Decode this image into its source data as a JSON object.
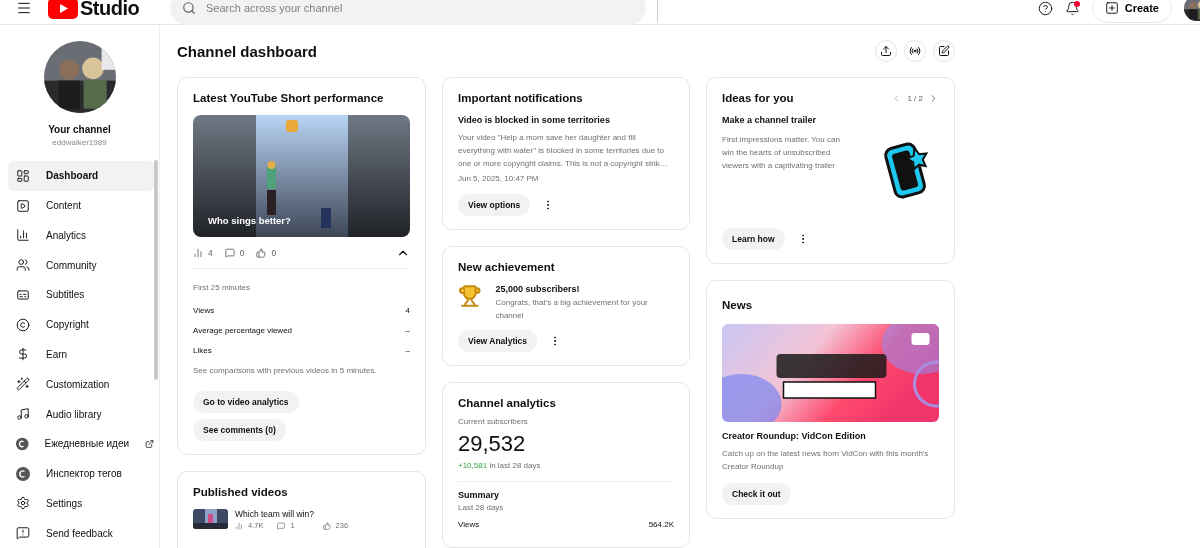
{
  "header": {
    "logo": "Studio",
    "search_placeholder": "Search across your channel",
    "create_label": "Create",
    "notifications_unread": true
  },
  "sidebar": {
    "channel_name": "Your channel",
    "channel_handle": "eddwalker1989",
    "items": [
      {
        "label": "Dashboard",
        "selected": true,
        "external": false
      },
      {
        "label": "Content",
        "selected": false,
        "external": false
      },
      {
        "label": "Analytics",
        "selected": false,
        "external": false
      },
      {
        "label": "Community",
        "selected": false,
        "external": false
      },
      {
        "label": "Subtitles",
        "selected": false,
        "external": false
      },
      {
        "label": "Copyright",
        "selected": false,
        "external": false
      },
      {
        "label": "Earn",
        "selected": false,
        "external": false
      },
      {
        "label": "Customization",
        "selected": false,
        "external": false
      },
      {
        "label": "Audio library",
        "selected": false,
        "external": false
      },
      {
        "label": "Ежедневные идеи",
        "selected": false,
        "external": true
      },
      {
        "label": "Инспектор тегов",
        "selected": false,
        "external": false
      },
      {
        "label": "Settings",
        "selected": false,
        "external": false
      },
      {
        "label": "Send feedback",
        "selected": false,
        "external": false
      }
    ]
  },
  "page_title": "Channel dashboard",
  "short_card": {
    "title": "Latest YouTube Short performance",
    "caption": "Who sings better?",
    "views": "4",
    "comments": "0",
    "likes": "0",
    "expanded": true,
    "period": "First 25 minutes",
    "metrics": [
      {
        "label": "Views",
        "value": "4"
      },
      {
        "label": "Average percentage viewed",
        "value": "–"
      },
      {
        "label": "Likes",
        "value": "–"
      }
    ],
    "note": "See comparisons with previous videos in 5 minutes.",
    "buttons": [
      "Go to video analytics",
      "See comments (0)"
    ]
  },
  "published_card": {
    "title": "Published videos",
    "videos": [
      {
        "title": "Which team will win?",
        "views": "4.7K",
        "comments": "1",
        "likes": "236"
      }
    ]
  },
  "notifications_card": {
    "title": "Important notifications",
    "heading": "Video is blocked in some territories",
    "body": "Your video \"Help a mom save her daughter and fill everything with water\" is blocked in some territories due to one or more copyright claims. This is not a copyright strik…",
    "date": "Jun 5, 2025, 10:47 PM",
    "button": "View options"
  },
  "achievement_card": {
    "title": "New achievement",
    "heading": "25,000 subscribers!",
    "body": "Congrats, that's a big achievement for your channel",
    "button": "View Analytics"
  },
  "analytics_card": {
    "title": "Channel analytics",
    "subscribers_label": "Current subscribers",
    "subscribers": "29,532",
    "change": "+10,581",
    "change_suffix": "in last 28 days",
    "summary_title": "Summary",
    "summary_period": "Last 28 days",
    "metrics": [
      {
        "label": "Views",
        "value": "564.2K"
      }
    ]
  },
  "ideas_card": {
    "title": "Ideas for you",
    "pager": "1 / 2",
    "heading": "Make a channel trailer",
    "body": "First impressions matter. You can win the hearts of unsubscribed viewers with a captivating trailer",
    "button": "Learn how"
  },
  "news_card": {
    "title": "News",
    "heading": "Creator Roundup: VidCon Edition",
    "body": "Catch up on the latest news from VidCon with this month's Creator Roundup",
    "button": "Check it out"
  }
}
